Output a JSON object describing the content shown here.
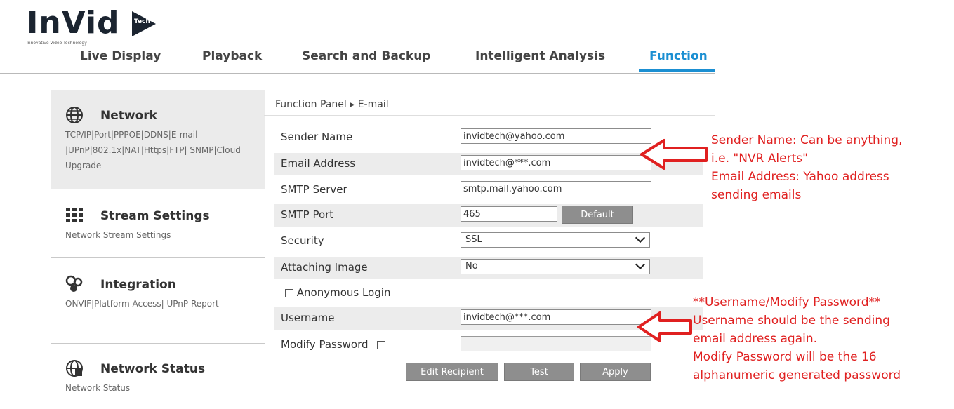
{
  "logo": {
    "text": "InVid",
    "badge": "Tech",
    "tagline": "Innovative Video Technology"
  },
  "topnav": {
    "tabs": [
      "Live Display",
      "Playback",
      "Search and Backup",
      "Intelligent Analysis",
      "Function"
    ],
    "active": "Function"
  },
  "sidebar": {
    "sections": [
      {
        "icon": "globe-icon",
        "title": "Network",
        "sub": "TCP/IP|Port|PPPOE|DDNS|E-mail |UPnP|802.1x|NAT|Https|FTP| SNMP|Cloud Upgrade"
      },
      {
        "icon": "grid-icon",
        "title": "Stream Settings",
        "sub": "Network Stream Settings"
      },
      {
        "icon": "integration-icon",
        "title": "Integration",
        "sub": "ONVIF|Platform Access| UPnP Report"
      },
      {
        "icon": "network-status-icon",
        "title": "Network Status",
        "sub": "Network Status"
      }
    ]
  },
  "breadcrumb": "Function Panel ▸ E-mail",
  "form": {
    "sender_name_label": "Sender Name",
    "sender_name_value": "invidtech@yahoo.com",
    "email_label": "Email Address",
    "email_value": "invidtech@***.com",
    "smtp_server_label": "SMTP Server",
    "smtp_server_value": "smtp.mail.yahoo.com",
    "smtp_port_label": "SMTP Port",
    "smtp_port_value": "465",
    "default_button": "Default",
    "security_label": "Security",
    "security_value": "SSL",
    "attaching_label": "Attaching Image",
    "attaching_value": "No",
    "anonymous_label": "Anonymous Login",
    "username_label": "Username",
    "username_value": "invidtech@***.com",
    "modify_password_label": "Modify Password",
    "edit_recipient_button": "Edit Recipient",
    "test_button": "Test",
    "apply_button": "Apply"
  },
  "annotations": {
    "note1": [
      "Sender Name: Can be anything,",
      "i.e. \"NVR Alerts\"",
      "Email Address: Yahoo address",
      "sending emails"
    ],
    "note2": [
      "**Username/Modify Password**",
      "Username should be the sending",
      "email address again.",
      "Modify Password will be the 16",
      "alphanumeric generated password"
    ],
    "color": "#e02020"
  },
  "colors": {
    "accent": "#1b8fd2",
    "button": "#8e8e8e",
    "shade": "#ececec"
  }
}
